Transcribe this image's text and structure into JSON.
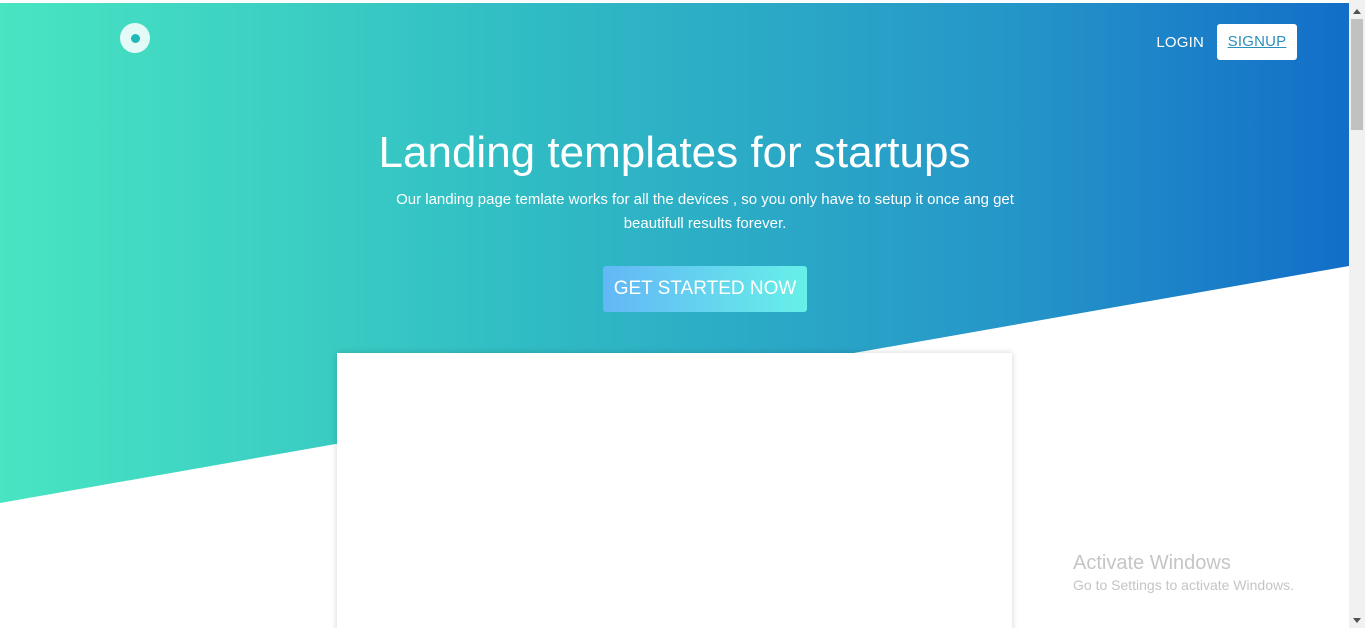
{
  "nav": {
    "login_label": "LOGIN",
    "signup_label": "SIGNUP"
  },
  "hero": {
    "title": "Landing templates for startups",
    "subtitle": "Our landing page temlate works for all the devices , so you only have to setup it once ang get beautifull results forever.",
    "cta_label": "GET STARTED NOW"
  },
  "watermark": {
    "title": "Activate Windows",
    "subtitle": "Go to Settings to activate Windows."
  },
  "colors": {
    "gradient_start": "#48e5c2",
    "gradient_end": "#126ec8",
    "cta_start": "#63b7f6",
    "cta_end": "#66f0e8",
    "signup_text": "#2b8fbc"
  }
}
